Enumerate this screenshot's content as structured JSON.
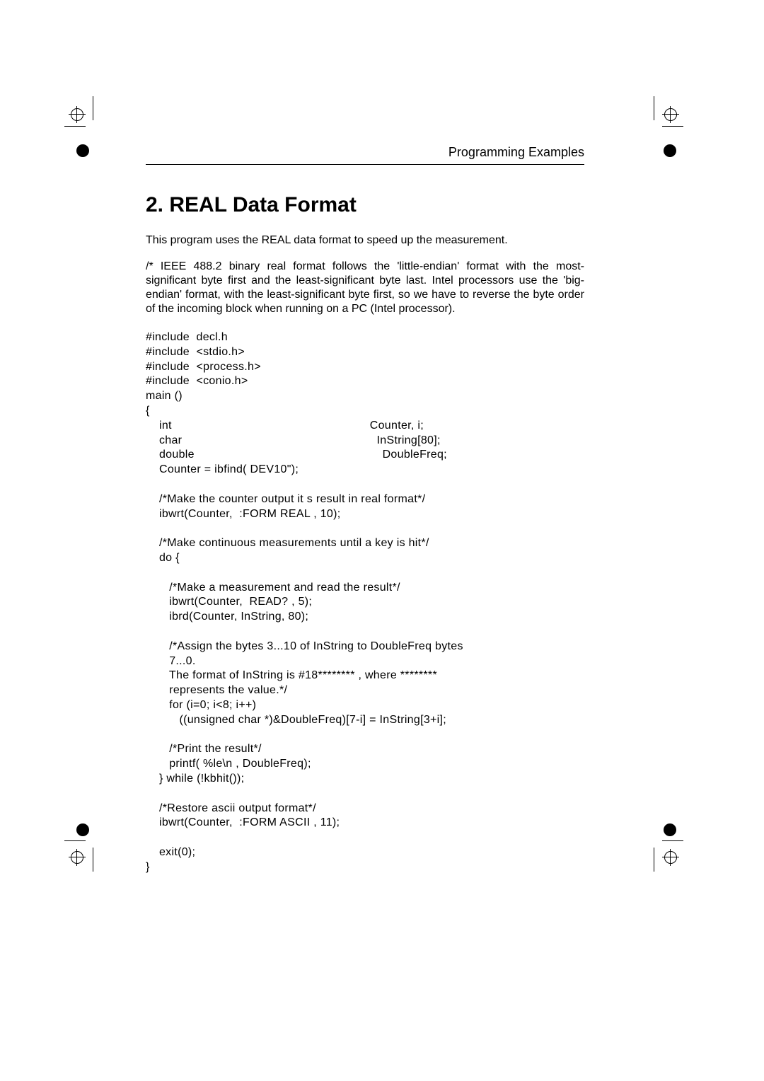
{
  "header": "Programming Examples",
  "title": "2. REAL Data Format",
  "intro": "This program uses the REAL data format to speed up the measurement.",
  "paragraph": "/* IEEE 488.2 binary real format follows the 'little-endian' format with the most-significant byte first and the least-significant byte last. Intel processors use the 'big-endian' format, with the least-significant byte first, so we have to reverse the byte order of the incoming block when running on a PC (Intel processor).",
  "code": "#include  decl.h\n#include  <stdio.h>\n#include  <process.h>\n#include  <conio.h>\nmain ()\n{\n    int                                                           Counter, i;\n    char                                                          InString[80];\n    double                                                        DoubleFreq;\n    Counter = ibfind( DEV10\");\n\n    /*Make the counter output it s result in real format*/\n    ibwrt(Counter,  :FORM REAL , 10);\n\n    /*Make continuous measurements until a key is hit*/\n    do {\n\n       /*Make a measurement and read the result*/\n       ibwrt(Counter,  READ? , 5);\n       ibrd(Counter, InString, 80);\n\n       /*Assign the bytes 3...10 of InString to DoubleFreq bytes\n       7...0.\n       The format of InString is #18******** , where ********\n       represents the value.*/\n       for (i=0; i<8; i++)\n          ((unsigned char *)&DoubleFreq)[7-i] = InString[3+i];\n\n       /*Print the result*/\n       printf( %le\\n , DoubleFreq);\n    } while (!kbhit());\n\n    /*Restore ascii output format*/\n    ibwrt(Counter,  :FORM ASCII , 11);\n\n    exit(0);\n}"
}
